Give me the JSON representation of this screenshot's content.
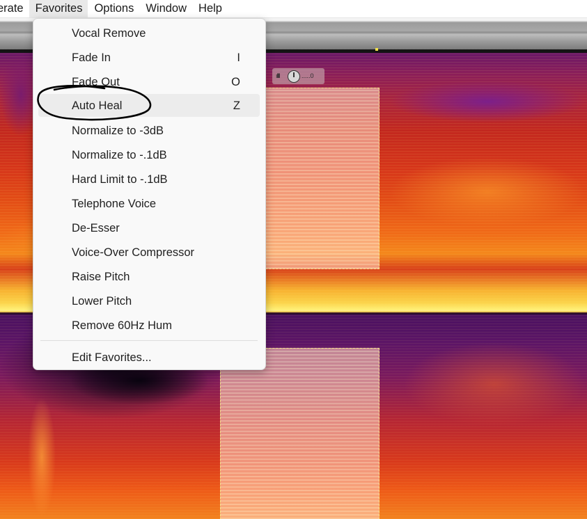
{
  "menubar": {
    "items": [
      {
        "label": "erate"
      },
      {
        "label": "Favorites"
      },
      {
        "label": "Options"
      },
      {
        "label": "Window"
      },
      {
        "label": "Help"
      }
    ]
  },
  "hud": {
    "readout": "0"
  },
  "favorites_menu": {
    "items": [
      {
        "label": "Vocal Remove",
        "shortcut": ""
      },
      {
        "label": "Fade In",
        "shortcut": "I"
      },
      {
        "label": "Fade Out",
        "shortcut": "O"
      },
      {
        "label": "Auto Heal",
        "shortcut": "Z"
      },
      {
        "label": "Normalize to -3dB",
        "shortcut": ""
      },
      {
        "label": "Normalize to -.1dB",
        "shortcut": ""
      },
      {
        "label": "Hard Limit to -.1dB",
        "shortcut": ""
      },
      {
        "label": "Telephone Voice",
        "shortcut": ""
      },
      {
        "label": "De-Esser",
        "shortcut": ""
      },
      {
        "label": "Voice-Over Compressor",
        "shortcut": ""
      },
      {
        "label": "Raise Pitch",
        "shortcut": ""
      },
      {
        "label": "Lower Pitch",
        "shortcut": ""
      },
      {
        "label": "Remove 60Hz Hum",
        "shortcut": ""
      }
    ],
    "edit_label": "Edit Favorites...",
    "highlighted": "Auto Heal"
  },
  "colors": {
    "menu_bg": "#f9f9f9",
    "highlight": "#ececec",
    "selection_border": "#f6e38a"
  }
}
